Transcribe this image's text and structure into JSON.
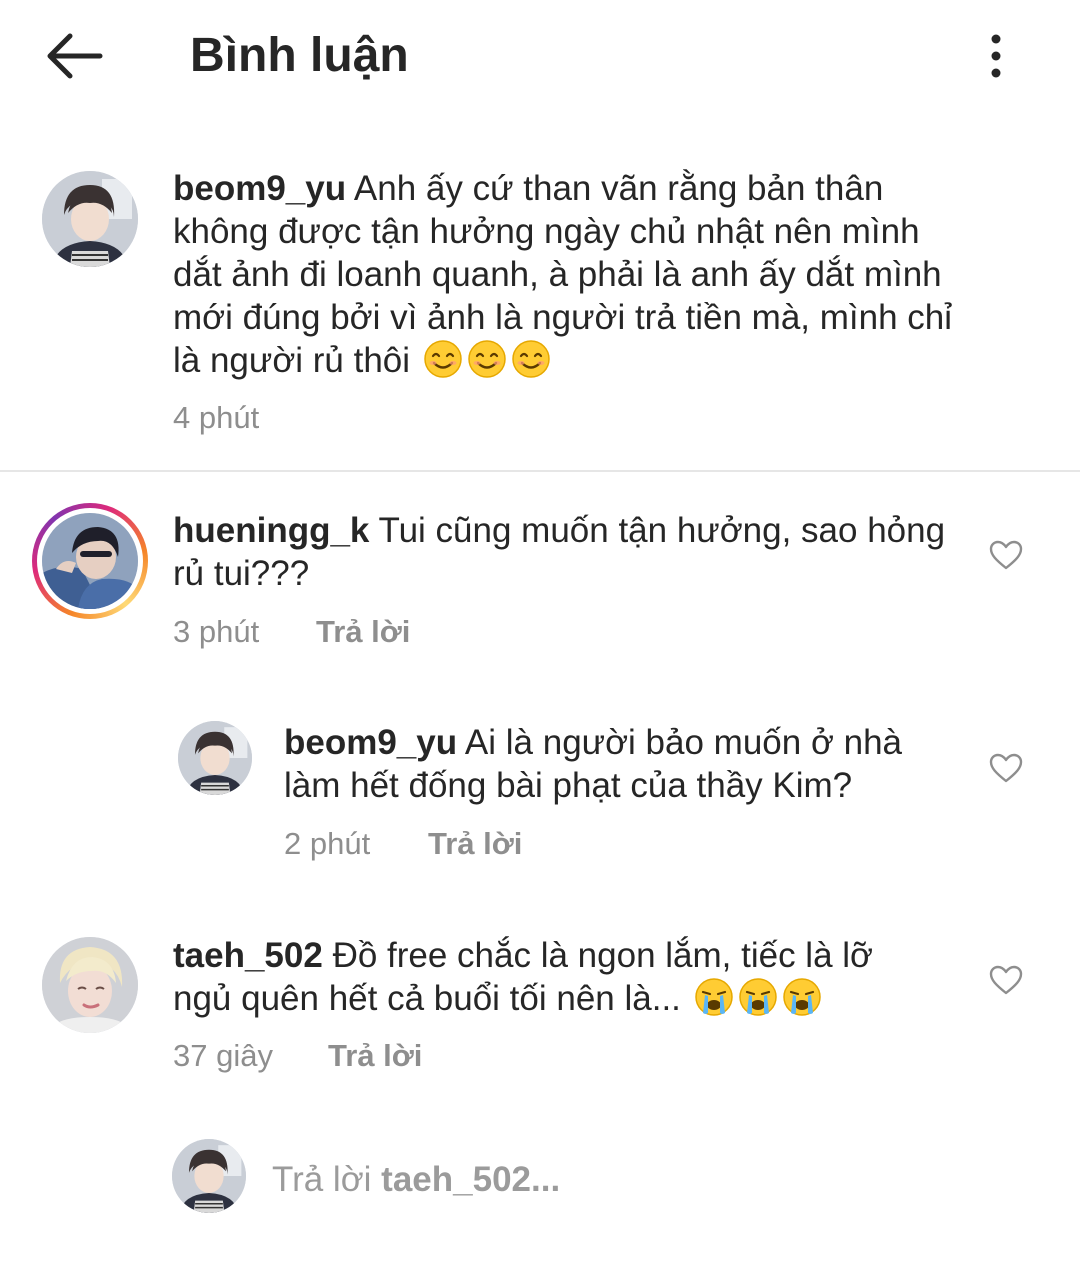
{
  "header": {
    "title": "Bình luận",
    "back_icon": "arrow-left-icon",
    "more_icon": "more-vertical-icon"
  },
  "caption": {
    "username": "beom9_yu",
    "lines": [
      "Anh ấy cứ than vãn rằng bản thân",
      "không được tận hưởng ngày chủ nhật nên mình",
      "dắt ảnh đi loanh quanh, à phải là anh ấy dắt mình",
      "mới đúng bởi vì ảnh là người trả tiền mà, mình chỉ",
      "là người rủ thôi"
    ],
    "emoji": "smiling-face-emoji",
    "time": "4 phút"
  },
  "comments": [
    {
      "username": "hueningg_k",
      "lines": [
        "Tui cũng muốn tận hưởng, sao hỏng",
        "rủ tui???"
      ],
      "time": "3 phút",
      "reply_label": "Trả lời",
      "has_story": true
    },
    {
      "username": "beom9_yu",
      "lines": [
        "Ai là người bảo muốn ở nhà",
        "làm hết đống bài phạt của thầy Kim?"
      ],
      "time": "2 phút",
      "reply_label": "Trả lời",
      "is_reply": true
    },
    {
      "username": "taeh_502",
      "lines": [
        "Đồ free chắc là ngon lắm, tiếc là lỡ",
        "ngủ quên hết cả buổi tối nên là..."
      ],
      "emoji": "crying-face-emoji",
      "time": "37 giây",
      "reply_label": "Trả lời"
    }
  ],
  "reply_bar": {
    "prefix": "Trả lời",
    "target": "taeh_502..."
  },
  "colors": {
    "text": "#262626",
    "secondary": "#8e8e8e",
    "divider": "#e6e6e6"
  }
}
